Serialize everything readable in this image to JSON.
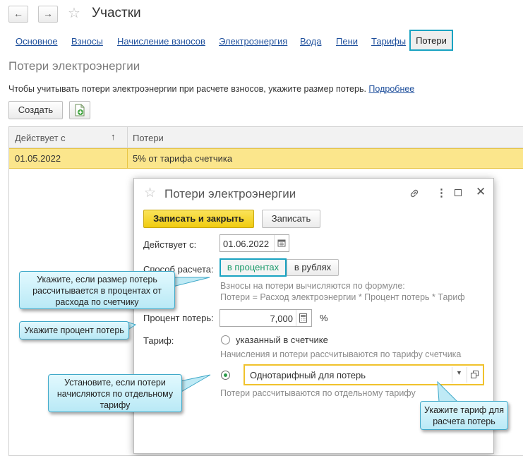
{
  "window": {
    "title": "Участки"
  },
  "tabs": [
    "Основное",
    "Взносы",
    "Начисление взносов",
    "Электроэнергия",
    "Вода",
    "Пени",
    "Тарифы",
    "Потери"
  ],
  "section": {
    "title": "Потери электроэнергии",
    "info_text": "Чтобы учитывать потери электроэнергии при расчете взносов, укажите размер потерь.",
    "info_link": "Подробнее"
  },
  "toolbar": {
    "create_label": "Создать",
    "add_icon": "add-document-icon"
  },
  "table": {
    "columns": [
      "Действует с",
      "Потери"
    ],
    "sort_indicator": "↑",
    "rows": [
      {
        "date": "01.05.2022",
        "value": "5% от тарифа счетчика"
      }
    ]
  },
  "dialog": {
    "title": "Потери электроэнергии",
    "save_close_label": "Записать и закрыть",
    "save_label": "Записать",
    "effective_label": "Действует с:",
    "effective_value": "01.06.2022",
    "method_label": "Способ расчета:",
    "method_option_percent": "в процентах",
    "method_option_rubles": "в рублях",
    "formula_line1": "Взносы на потери вычисляются по формуле:",
    "formula_line2": "Потери = Расход электроэнергии * Процент потерь * Тариф",
    "percent_label": "Процент потерь:",
    "percent_value": "7,000",
    "percent_unit": "%",
    "tariff_label": "Тариф:",
    "tariff_option1": "указанный в счетчике",
    "tariff_option1_hint": "Начисления и потери рассчитываются по тарифу счетчика",
    "tariff_select_value": "Однотарифный для потерь",
    "tariff_option2_hint": "Потери рассчитываются по отдельному тарифу"
  },
  "callouts": {
    "percent_method": "Укажите, если размер потерь рассчитывается в процентах от расхода по счетчику",
    "percent_value": "Укажите процент потерь",
    "separate_tariff": "Установите, если потери начисляются по отдельному тарифу",
    "select_tariff": "Укажите тариф для расчета потерь"
  },
  "colors": {
    "accent_frame": "#1aa3c2",
    "primary_button": "#f5d61d",
    "row_highlight": "#fbe68c",
    "select_frame": "#f0c22c"
  }
}
